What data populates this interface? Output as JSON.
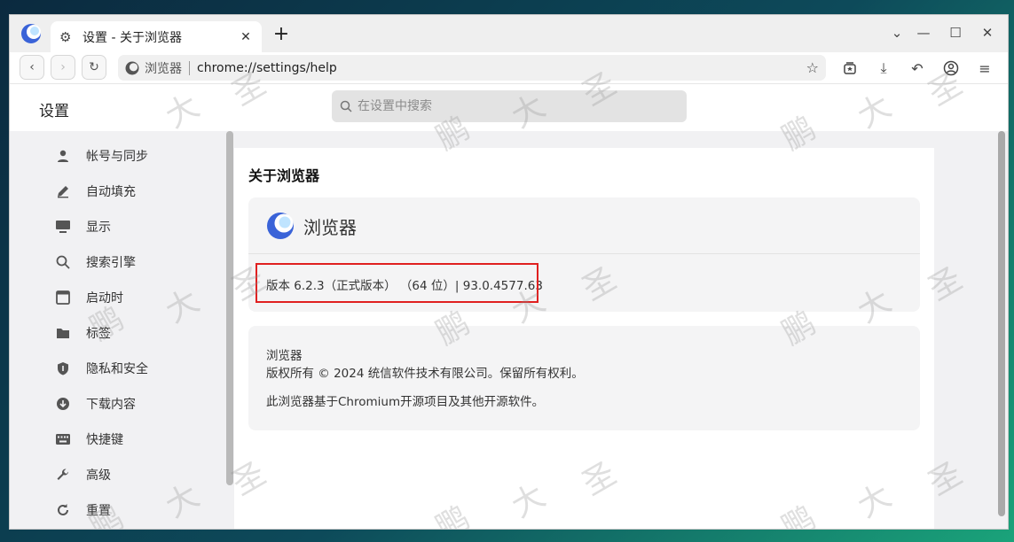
{
  "browser": {
    "tab_title": "设置 - 关于浏览器",
    "site_label": "浏览器",
    "url": "chrome://settings/help"
  },
  "settings": {
    "title": "设置",
    "search_placeholder": "在设置中搜索"
  },
  "sidebar": {
    "items": [
      {
        "label": "帐号与同步",
        "icon": "person-icon"
      },
      {
        "label": "自动填充",
        "icon": "pen-icon"
      },
      {
        "label": "显示",
        "icon": "monitor-icon"
      },
      {
        "label": "搜索引擎",
        "icon": "search-icon"
      },
      {
        "label": "启动时",
        "icon": "window-icon"
      },
      {
        "label": "标签",
        "icon": "folder-icon"
      },
      {
        "label": "隐私和安全",
        "icon": "shield-icon"
      },
      {
        "label": "下载内容",
        "icon": "download-icon"
      },
      {
        "label": "快捷键",
        "icon": "keyboard-icon"
      },
      {
        "label": "高级",
        "icon": "wrench-icon"
      },
      {
        "label": "重置",
        "icon": "reset-icon"
      }
    ]
  },
  "about": {
    "heading": "关于浏览器",
    "product_name": "浏览器",
    "version_text": "版本 6.2.3（正式版本） （64 位）| 93.0.4577.63",
    "copyright_title": "浏览器",
    "copyright_line": "版权所有 © 2024 统信软件技术有限公司。保留所有权利。",
    "based_on": "此浏览器基于Chromium开源项目及其他开源软件。"
  },
  "watermark": {
    "chars": [
      "鹏",
      "大",
      "圣"
    ]
  },
  "colors": {
    "highlight": "#e02020",
    "page_bg": "#f1f1f3"
  }
}
